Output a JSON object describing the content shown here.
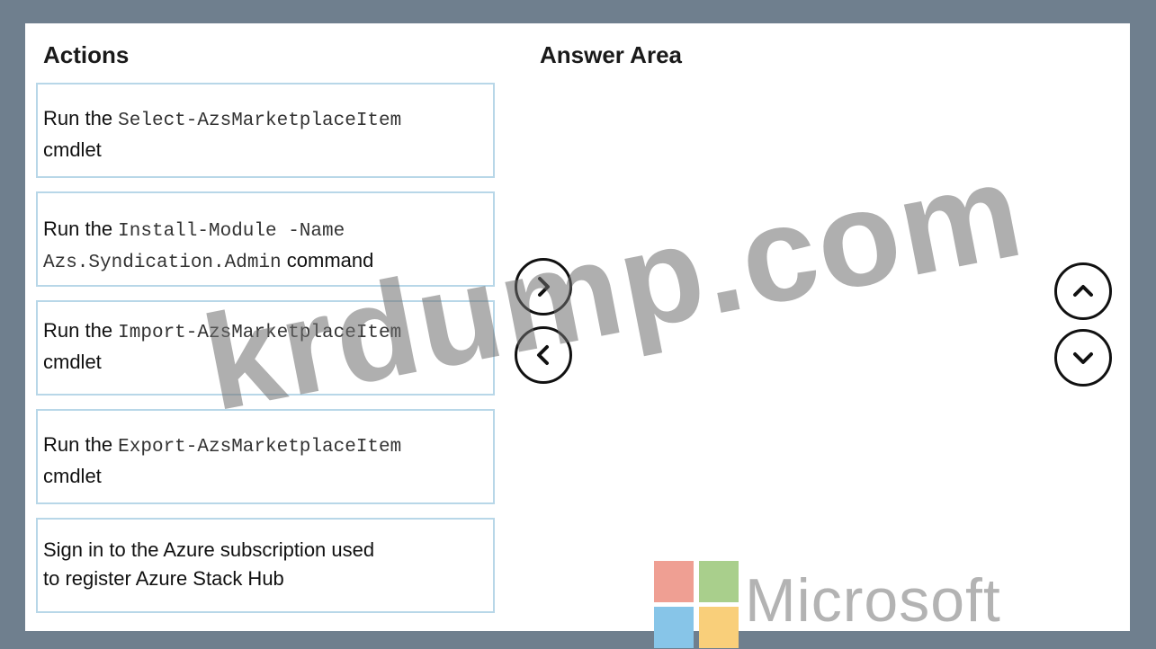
{
  "actions_heading": "Actions",
  "answer_area_heading": "Answer Area",
  "actions": [
    {
      "prefix": "Run the ",
      "code": "Select-AzsMarketplaceItem",
      "suffix": "cmdlet"
    },
    {
      "prefix": "Run the ",
      "code": "Install-Module -Name",
      "code2": "Azs.Syndication.Admin",
      "suffix": " command"
    },
    {
      "prefix": "Run the ",
      "code": "Import-AzsMarketplaceItem",
      "suffix": "cmdlet"
    },
    {
      "prefix": "Run the ",
      "code": "Export-AzsMarketplaceItem",
      "suffix": "cmdlet"
    },
    {
      "line1": "Sign in to the Azure subscription used",
      "line2": "to register Azure Stack Hub"
    }
  ],
  "buttons": {
    "move_right_icon": "chevron-right-icon",
    "move_left_icon": "chevron-left-icon",
    "move_up_icon": "chevron-up-icon",
    "move_down_icon": "chevron-down-icon"
  },
  "watermark": "krdump.com",
  "brand": {
    "name": "Microsoft",
    "colors": {
      "red": "#ef9f93",
      "green": "#a9cf8c",
      "blue": "#87c5e8",
      "yellow": "#f9cf7a"
    }
  }
}
